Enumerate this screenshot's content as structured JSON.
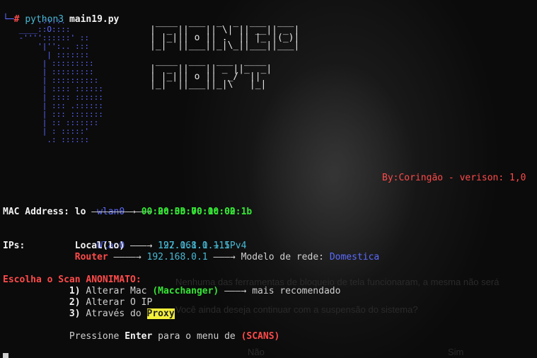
{
  "prompt": {
    "hash": "#",
    "command": "python3",
    "file": "main19.py"
  },
  "logo_text": [
    " ____  ___  _  _  ___  ___ ",
    "|  _ ||   || \\| || __|| _ |",
    "| |_||| o || .  || |_ |(_)|",
    "|_|  ||___||_|\\_||___||___|",
    "",
    " ____  ___  ___  ____      ",
    "|  _ ||   || _ ||_  _|     ",
    "| |_||| o ||  _/  ||       ",
    "|_|  ||___||_|\\   |_|      "
  ],
  "byline": "By:Coringão - verison: 1,0",
  "mac": {
    "label": "MAC Address:",
    "iface1": "wlan0",
    "arrow": "———→",
    "addr1": "2c:3b:70:1c:02:1b",
    "iface2": "lo",
    "arrow2": "———————→",
    "addr2": "00:00:00:00:00:00"
  },
  "ips": {
    "label": "IPs:",
    "wlan": "Wlan0",
    "wlan_arrow": "———→",
    "wlan_ip": "192.168.0.115",
    "local": "Local(lo)",
    "local_arrow": "———→",
    "local_ip": "127.0.1.1",
    "local_arrow2": "→",
    "local_ver": "IPv4",
    "router": "Router",
    "router_arrow": "————→",
    "router_ip": "192.168.0.1",
    "router_arrow2": "———→",
    "model_label": "Modelo de rede:",
    "model": "Domestica"
  },
  "menu": {
    "title": "Escolha o Scan ANONIMATO:",
    "opt1_num": "1)",
    "opt1": "Alterar Mac",
    "opt1_tool": "(Macchanger)",
    "opt1_arrow": "———→",
    "opt1_note": "mais recomendado",
    "opt2_num": "2)",
    "opt2": "Alterar O IP",
    "opt3_num": "3)",
    "opt3": "Através do",
    "opt3_tool": "Proxy"
  },
  "footer": {
    "press": "Pressione",
    "key": "Enter",
    "rest": "para o menu de",
    "target": "(SCANS)"
  },
  "ghost": {
    "line1": "Nenhuma das ferramentas de bloqueio de tela funcionaram, a mesma não será",
    "line2": "Você ainda deseja continuar com a suspensão do sistema?",
    "no": "Não",
    "yes": "Sim"
  },
  "colors": {
    "accent_blue": "#5b6bff",
    "green": "#35e635",
    "red": "#ff4a4a",
    "cyan": "#47b9d4",
    "highlight": "#f3ef3a"
  }
}
